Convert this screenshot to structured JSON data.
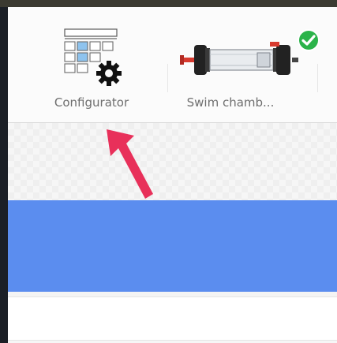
{
  "toolbar": {
    "configurator": {
      "label": "Configurator",
      "icon": "configurator-grid-gear-icon"
    },
    "swim_chamber": {
      "label": "Swim chamb...",
      "icon": "swim-chamber-icon",
      "status_icon": "check-circle-icon",
      "status_color": "#2bb34a"
    }
  },
  "selection": {
    "highlight_color": "#5b8def"
  },
  "annotation": {
    "icon": "pointer-arrow-icon",
    "color": "#e8305a"
  }
}
